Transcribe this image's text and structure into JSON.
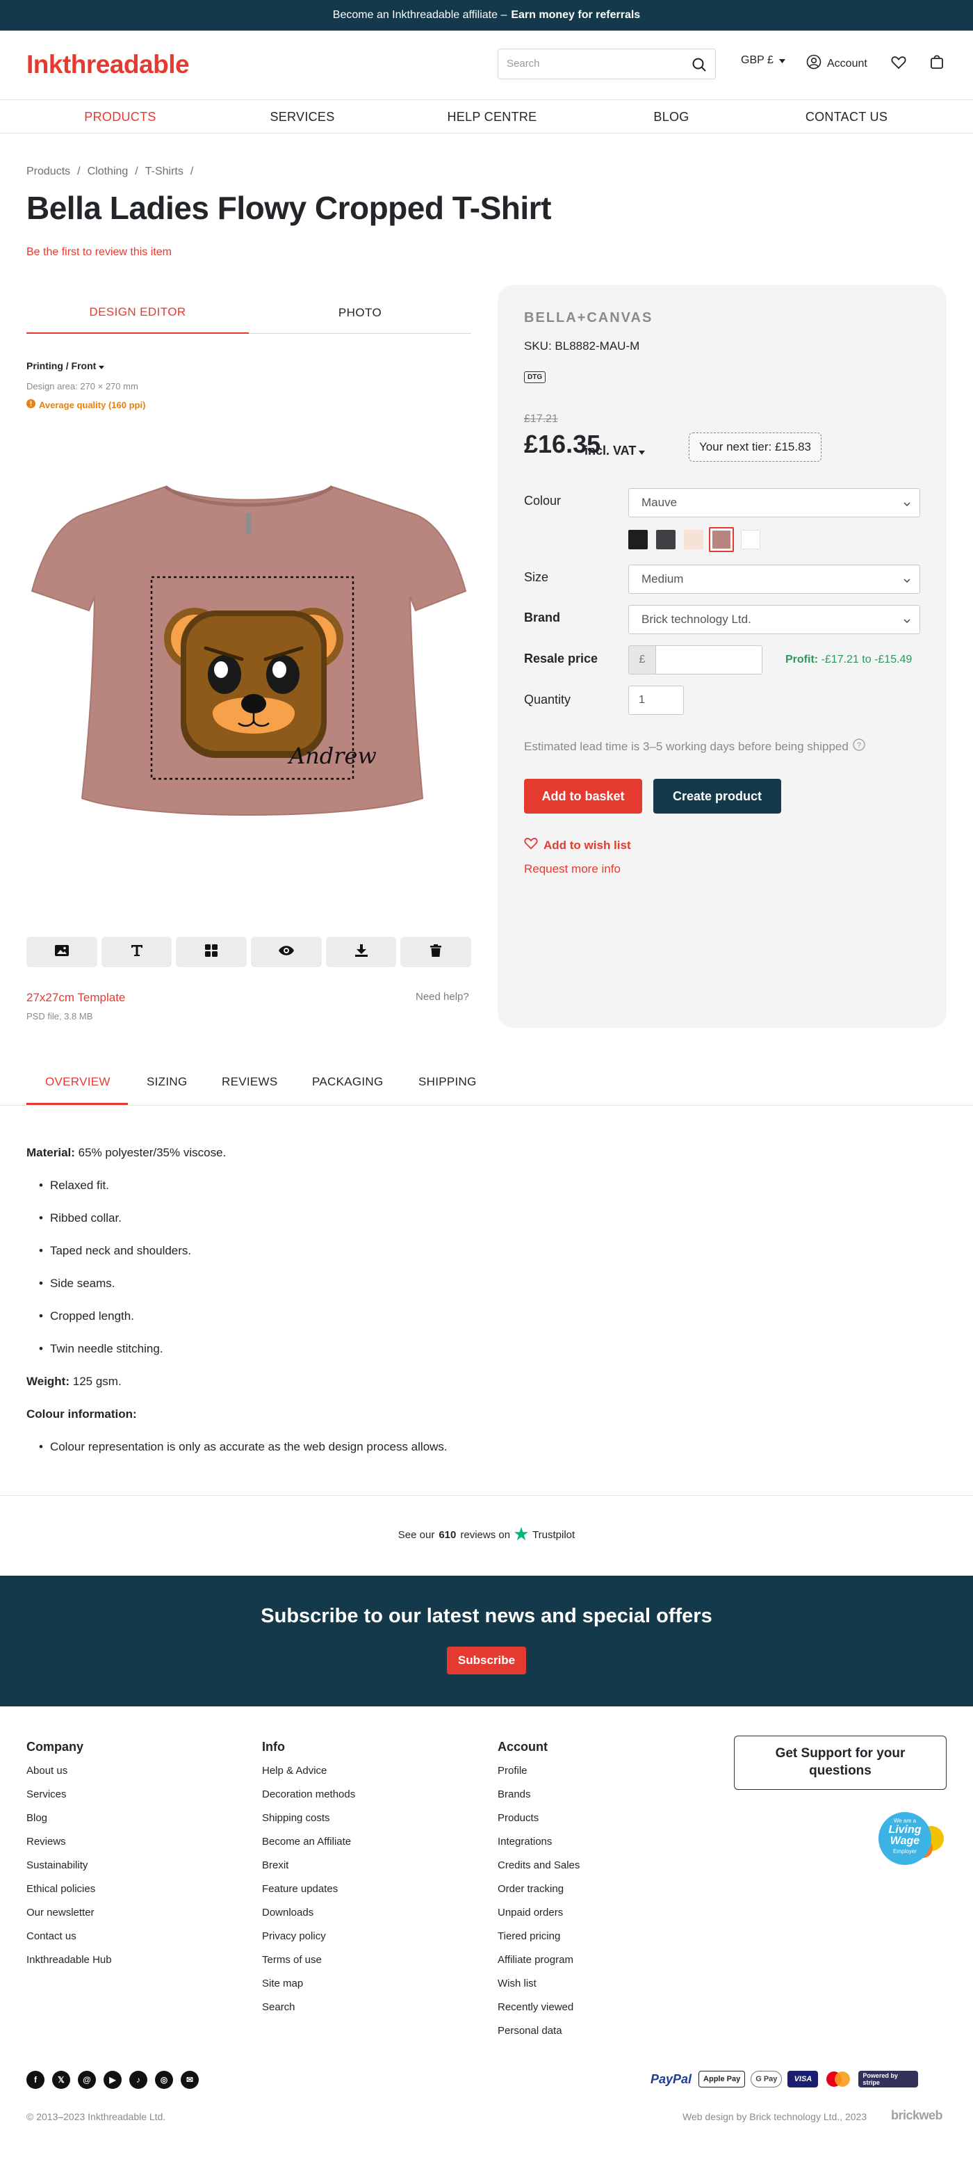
{
  "banner": {
    "text": "Become an Inkthreadable affiliate –",
    "cta": "Earn money for referrals"
  },
  "header": {
    "logo": "Inkthreadable",
    "search_placeholder": "Search",
    "currency": "GBP £",
    "account": "Account",
    "icons": [
      "search-icon",
      "user-icon",
      "heart-icon",
      "bag-icon"
    ]
  },
  "nav": {
    "items": [
      "PRODUCTS",
      "SERVICES",
      "HELP CENTRE",
      "BLOG",
      "CONTACT US"
    ],
    "active": "PRODUCTS"
  },
  "breadcrumbs": [
    "Products",
    "/",
    "Clothing",
    "/",
    "T-Shirts",
    "/"
  ],
  "product": {
    "title": "Bella Ladies Flowy Cropped T-Shirt",
    "review_link": "Be the first to review this item"
  },
  "editor": {
    "tabs": [
      "DESIGN EDITOR",
      "PHOTO"
    ],
    "active_tab": "DESIGN EDITOR",
    "printing": "Printing / Front",
    "design_area": "Design area: 270 × 270 mm",
    "quality": "Average quality (160 ppi)",
    "design_signature": "Andrew",
    "shirt_color": "#b8867f",
    "tools": [
      "image-icon",
      "text-icon",
      "grid-icon",
      "eye-icon",
      "download-icon",
      "trash-icon"
    ],
    "template_link": "27x27cm Template",
    "template_size": "PSD file, 3.8 MB",
    "need_help": "Need help?"
  },
  "panel": {
    "brand_logo": "BELLA+CANVAS",
    "sku": "SKU: BL8882-MAU-M",
    "badge": "DTG",
    "old_price": "£17.21",
    "price": "£16.35",
    "vat": "incl. VAT",
    "next_tier": "Your next tier: £15.83",
    "colour_label": "Colour",
    "colour_value": "Mauve",
    "swatches": [
      "#1e1e1e",
      "#3d3f42",
      "#f6e2d6",
      "#b8867f",
      "#ffffff"
    ],
    "selected_swatch": "#b8867f",
    "size_label": "Size",
    "size_value": "Medium",
    "brand_label": "Brand",
    "brand_value": "Brick technology Ltd.",
    "resale_label": "Resale price",
    "resale_currency": "£",
    "profit_label": "Profit:",
    "profit_value": "-£17.21 to -£15.49",
    "quantity_label": "Quantity",
    "quantity_value": "1",
    "lead_time": "Estimated lead time is 3–5 working days before being shipped",
    "add_basket": "Add to basket",
    "create_product": "Create product",
    "wishlist": "Add to wish list",
    "request_info": "Request more info"
  },
  "tabs": {
    "items": [
      "OVERVIEW",
      "SIZING",
      "REVIEWS",
      "PACKAGING",
      "SHIPPING"
    ],
    "active": "OVERVIEW"
  },
  "overview": {
    "material_label": "Material:",
    "material_value": "65% polyester/35% viscose.",
    "bullets": [
      "Relaxed fit.",
      "Ribbed collar.",
      "Taped neck and shoulders.",
      "Side seams.",
      "Cropped length.",
      "Twin needle stitching."
    ],
    "weight_label": "Weight:",
    "weight_value": "125 gsm.",
    "colour_info_label": "Colour information:",
    "colour_bullets": [
      "Colour representation is only as accurate as the web design process allows."
    ]
  },
  "trustpilot": {
    "prefix": "See our",
    "count": "610",
    "suffix": "reviews on",
    "brand": "Trustpilot"
  },
  "subscribe": {
    "title": "Subscribe to our latest news and special offers",
    "button": "Subscribe"
  },
  "footer": {
    "columns": [
      {
        "title": "Company",
        "links": [
          "About us",
          "Services",
          "Blog",
          "Reviews",
          "Sustainability",
          "Ethical policies",
          "Our newsletter",
          "Contact us",
          "Inkthreadable Hub"
        ]
      },
      {
        "title": "Info",
        "links": [
          "Help & Advice",
          "Decoration methods",
          "Shipping costs",
          "Become an Affiliate",
          "Brexit",
          "Feature updates",
          "Downloads",
          "Privacy policy",
          "Terms of use",
          "Site map",
          "Search"
        ]
      },
      {
        "title": "Account",
        "links": [
          "Profile",
          "Brands",
          "Products",
          "Integrations",
          "Credits and Sales",
          "Order tracking",
          "Unpaid orders",
          "Tiered pricing",
          "Affiliate program",
          "Wish list",
          "Recently viewed",
          "Personal data"
        ]
      }
    ],
    "support": "Get Support for your questions",
    "living_wage": {
      "line1": "We are a",
      "line2": "Living",
      "line3": "Wage",
      "line4": "Employer"
    },
    "socials": [
      "facebook-icon",
      "x-icon",
      "threads-icon",
      "youtube-icon",
      "tiktok-icon",
      "instagram-icon",
      "email-icon"
    ],
    "payments": [
      "PayPal",
      "Apple Pay",
      "G Pay",
      "VISA",
      "mastercard",
      "Powered by stripe"
    ],
    "copyright": "© 2013–2023 Inkthreadable Ltd.",
    "web_design": "Web design by Brick technology Ltd., 2023",
    "brickweb": "brickweb"
  }
}
